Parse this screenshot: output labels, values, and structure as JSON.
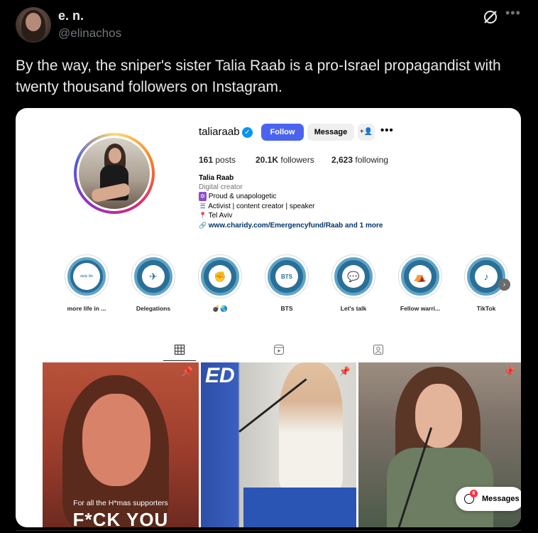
{
  "tweet": {
    "display_name": "e. n.",
    "handle": "@elinachos",
    "text": "By the way, the sniper's sister Talia Raab is a pro-Israel propagandist with twenty thousand followers on Instagram."
  },
  "instagram": {
    "username": "taliaraab",
    "follow_label": "Follow",
    "message_label": "Message",
    "stats": {
      "posts_count": "161",
      "posts_label": "posts",
      "followers_count": "20.1K",
      "followers_label": "followers",
      "following_count": "2,623",
      "following_label": "following"
    },
    "bio": {
      "name": "Talia Raab",
      "category": "Digital creator",
      "line1": "Proud & unapologetic",
      "line2": "Activist | content creator | speaker",
      "line3": "Tel Aviv",
      "link": "www.charidy.com/Emergencyfund/Raab and 1 more"
    },
    "highlights": [
      {
        "label": "more life in ...",
        "inner": "daily life"
      },
      {
        "label": "Delegations",
        "inner": "✈"
      },
      {
        "label": "💣🌏",
        "inner": "✊"
      },
      {
        "label": "BTS",
        "inner": "BTS"
      },
      {
        "label": "Let's talk",
        "inner": "💬"
      },
      {
        "label": "Fellow warri...",
        "inner": "⛺"
      },
      {
        "label": "TikTok",
        "inner": "♪"
      }
    ],
    "posts": {
      "post1_caption": "For all the H*mas supporters",
      "post1_big": "F*CK YOU",
      "post2_sign": "ED"
    },
    "messages_label": "Messages",
    "messages_badge": "6"
  },
  "colors": {
    "follow_button": "#4a64f0",
    "verified": "#0095f6",
    "highlight": "#2a6f96"
  }
}
